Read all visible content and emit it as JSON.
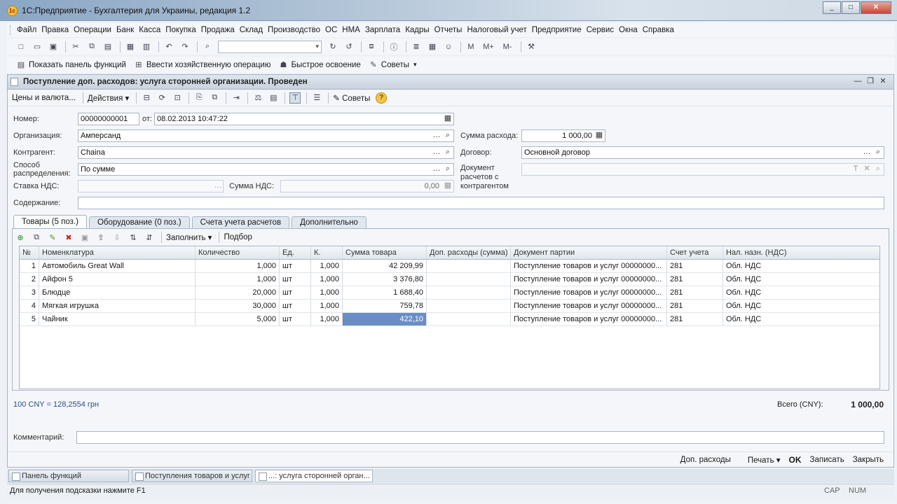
{
  "window": {
    "title": "1С:Предприятие - Бухгалтерия для Украины, редакция 1.2",
    "app_icon": "1c",
    "controls": [
      "_",
      "□",
      "✕"
    ]
  },
  "menu": [
    "Файл",
    "Правка",
    "Операции",
    "Банк",
    "Касса",
    "Покупка",
    "Продажа",
    "Склад",
    "Производство",
    "ОС",
    "НМА",
    "Зарплата",
    "Кадры",
    "Отчеты",
    "Налоговый учет",
    "Предприятие",
    "Сервис",
    "Окна",
    "Справка"
  ],
  "toolbar2": {
    "show_panel": "Показать панель функций",
    "enter_operation": "Ввести хозяйственную операцию",
    "quick_learn": "Быстрое освоение",
    "tips": "Советы",
    "mk_labels": [
      "M",
      "M+",
      "M-"
    ]
  },
  "document": {
    "title": "Поступление доп. расходов: услуга сторонней организации. Проведен",
    "toolbar": {
      "prices": "Цены и валюта...",
      "actions": "Действия",
      "tips": "Советы",
      "help": "?"
    },
    "labels": {
      "number": "Номер:",
      "from": "от:",
      "organization": "Организация:",
      "contractor": "Контрагент:",
      "distribution": "Способ распределения:",
      "vat_rate": "Ставка НДС:",
      "vat_sum": "Сумма НДС:",
      "content": "Содержание:",
      "expense_sum": "Сумма расхода:",
      "contract": "Договор:",
      "settlement_doc": "Документ расчетов с контрагентом"
    },
    "values": {
      "number": "00000000001",
      "date": "08.02.2013 10:47:22",
      "organization": "Амперсанд",
      "contractor": "Chaina",
      "distribution": "По сумме",
      "vat_rate": "",
      "vat_sum": "0,00",
      "content": "",
      "expense_sum": "1 000,00",
      "contract": "Основной договор",
      "settlement_doc": ""
    },
    "tabs": [
      "Товары (5 поз.)",
      "Оборудование (0 поз.)",
      "Счета учета расчетов",
      "Дополнительно"
    ],
    "tab_tools": {
      "fill": "Заполнить",
      "select": "Подбор"
    },
    "table": {
      "columns": [
        "№",
        "Номенклатура",
        "Количество",
        "Ед.",
        "К.",
        "Сумма товара",
        "Доп. расходы (сумма)",
        "Документ партии",
        "Счет учета",
        "Нал. назн. (НДС)"
      ],
      "rows": [
        {
          "n": "1",
          "name": "Автомобиль Great Wall",
          "qty": "1,000",
          "unit": "шт",
          "k": "1,000",
          "sum": "42 209,99",
          "extra": "",
          "doc": "Поступление товаров и услуг 00000000...",
          "account": "281",
          "tax": "Обл. НДС"
        },
        {
          "n": "2",
          "name": "Айфон 5",
          "qty": "1,000",
          "unit": "шт",
          "k": "1,000",
          "sum": "3 376,80",
          "extra": "",
          "doc": "Поступление товаров и услуг 00000000...",
          "account": "281",
          "tax": "Обл. НДС"
        },
        {
          "n": "3",
          "name": "Блюдце",
          "qty": "20,000",
          "unit": "шт",
          "k": "1,000",
          "sum": "1 688,40",
          "extra": "",
          "doc": "Поступление товаров и услуг 00000000...",
          "account": "281",
          "tax": "Обл. НДС"
        },
        {
          "n": "4",
          "name": "Мягкая игрушка",
          "qty": "30,000",
          "unit": "шт",
          "k": "1,000",
          "sum": "759,78",
          "extra": "",
          "doc": "Поступление товаров и услуг 00000000...",
          "account": "281",
          "tax": "Обл. НДС"
        },
        {
          "n": "5",
          "name": "Чайник",
          "qty": "5,000",
          "unit": "шт",
          "k": "1,000",
          "sum": "422,10",
          "extra": "",
          "doc": "Поступление товаров и услуг 00000000...",
          "account": "281",
          "tax": "Обл. НДС"
        }
      ]
    },
    "rate": "100 CNY = 128,2554 грн",
    "total_label": "Всего (CNY):",
    "total_value": "1 000,00",
    "comment_label": "Комментарий:",
    "comment": "",
    "bottom": {
      "extra": "Доп. расходы",
      "print": "Печать",
      "ok": "OK",
      "save": "Записать",
      "close": "Закрыть"
    }
  },
  "taskbar": [
    "Панель функций",
    "Поступления товаров и услуг",
    "...: услуга сторонней орган..."
  ],
  "status": {
    "hint": "Для получения подсказки нажмите F1",
    "cap": "CAP",
    "num": "NUM"
  }
}
